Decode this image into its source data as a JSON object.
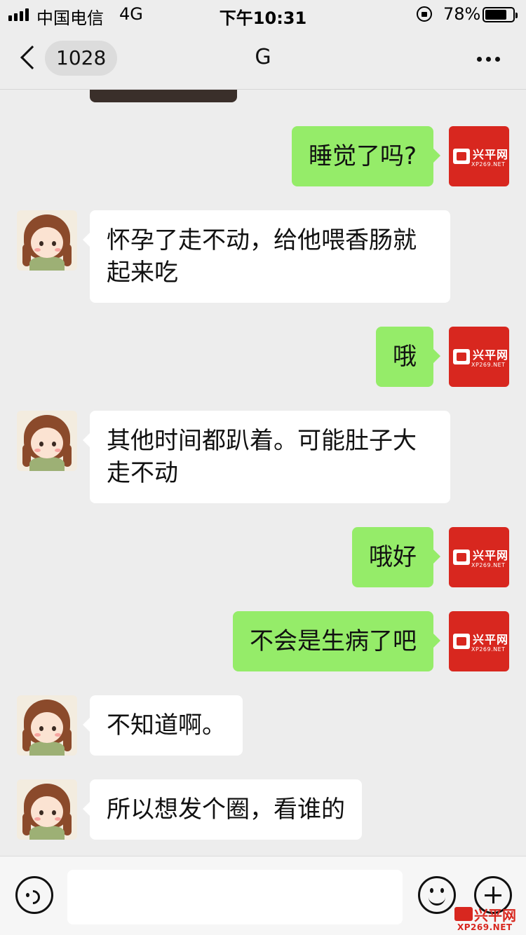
{
  "status_bar": {
    "carrier": "中国电信",
    "network": "4G",
    "time": "下午10:31",
    "battery_percent": "78%",
    "battery_level": 0.78
  },
  "nav": {
    "unread_count": "1028",
    "title": "G"
  },
  "messages": [
    {
      "side": "out",
      "text": "睡觉了吗?"
    },
    {
      "side": "in",
      "text": "怀孕了走不动，给他喂香肠就起来吃"
    },
    {
      "side": "out",
      "text": "哦"
    },
    {
      "side": "in",
      "text": "其他时间都趴着。可能肚子大走不动"
    },
    {
      "side": "out",
      "text": "哦好"
    },
    {
      "side": "out",
      "text": "不会是生病了吧"
    },
    {
      "side": "in",
      "text": "不知道啊。"
    },
    {
      "side": "in",
      "text": "所以想发个圈，看谁的"
    }
  ],
  "my_avatar": {
    "title": "兴平网",
    "subtitle": "XP269.NET"
  },
  "watermark": {
    "title": "兴平网",
    "subtitle": "XP269.NET"
  },
  "icons": {
    "back": "chevron-left-icon",
    "more": "more-dots-icon",
    "voice": "voice-icon",
    "emoji": "emoji-icon",
    "plus": "plus-icon"
  },
  "colors": {
    "outgoing_bubble": "#95ec69",
    "incoming_bubble": "#ffffff",
    "background": "#ededed",
    "brand_red": "#d8271f"
  }
}
